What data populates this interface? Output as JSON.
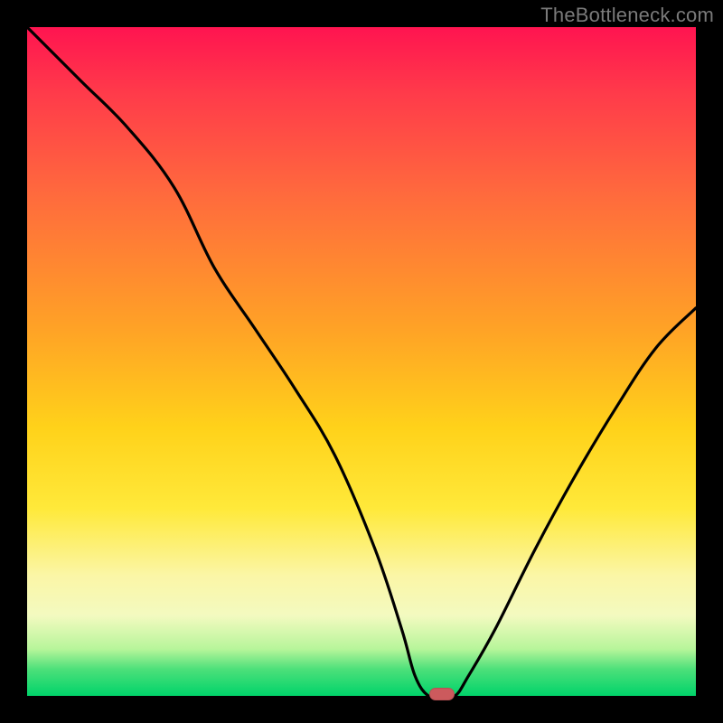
{
  "watermark": "TheBottleneck.com",
  "colors": {
    "frame": "#000000",
    "marker": "#cc5a5d",
    "curve": "#000000"
  },
  "chart_data": {
    "type": "line",
    "title": "",
    "xlabel": "",
    "ylabel": "",
    "xlim": [
      0,
      100
    ],
    "ylim": [
      0,
      100
    ],
    "series": [
      {
        "name": "bottleneck-curve",
        "x": [
          0,
          8,
          15,
          22,
          28,
          34,
          40,
          46,
          52,
          56,
          58,
          60,
          62,
          64,
          66,
          70,
          76,
          82,
          88,
          94,
          100
        ],
        "y": [
          100,
          92,
          85,
          76,
          64,
          55,
          46,
          36,
          22,
          10,
          3,
          0,
          0,
          0,
          3,
          10,
          22,
          33,
          43,
          52,
          58
        ]
      }
    ],
    "marker": {
      "x": 62,
      "y": 0
    },
    "gradient_stops": [
      {
        "pos": 0.0,
        "color": "#ff1450"
      },
      {
        "pos": 0.25,
        "color": "#ff6a3d"
      },
      {
        "pos": 0.55,
        "color": "#ffd21a"
      },
      {
        "pos": 0.82,
        "color": "#fbf6a6"
      },
      {
        "pos": 0.96,
        "color": "#4de07a"
      },
      {
        "pos": 1.0,
        "color": "#00d36a"
      }
    ]
  }
}
